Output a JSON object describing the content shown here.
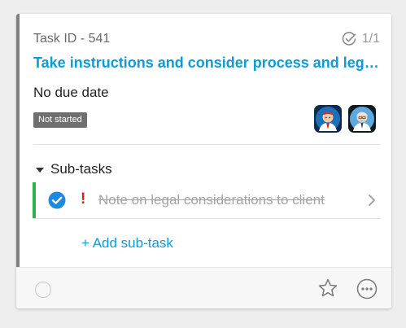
{
  "task": {
    "id_label": "Task ID - 541",
    "checklist_count": "1/1",
    "title": "Take instructions and consider process and legal options",
    "due_date": "No due date",
    "status": "Not started",
    "assignees": [
      "assignee-avatar-1",
      "assignee-avatar-2"
    ]
  },
  "subtasks": {
    "header": "Sub-tasks",
    "items": [
      {
        "priority_mark": "!",
        "text": "Note on legal considerations to client",
        "completed": true
      }
    ],
    "add_label": "+ Add sub-task"
  },
  "colors": {
    "accent": "#0f9bd7",
    "complete": "#2db34a",
    "priority": "#e0201f",
    "card_stripe": "#7f7f7f"
  },
  "icons": {
    "checklist": "check-circle-icon",
    "subtask_complete": "checkmark-circle-icon",
    "subtask_open": "chevron-right-icon",
    "complete_task": "circle-icon",
    "favorite": "star-icon",
    "more": "more-horizontal-icon"
  }
}
